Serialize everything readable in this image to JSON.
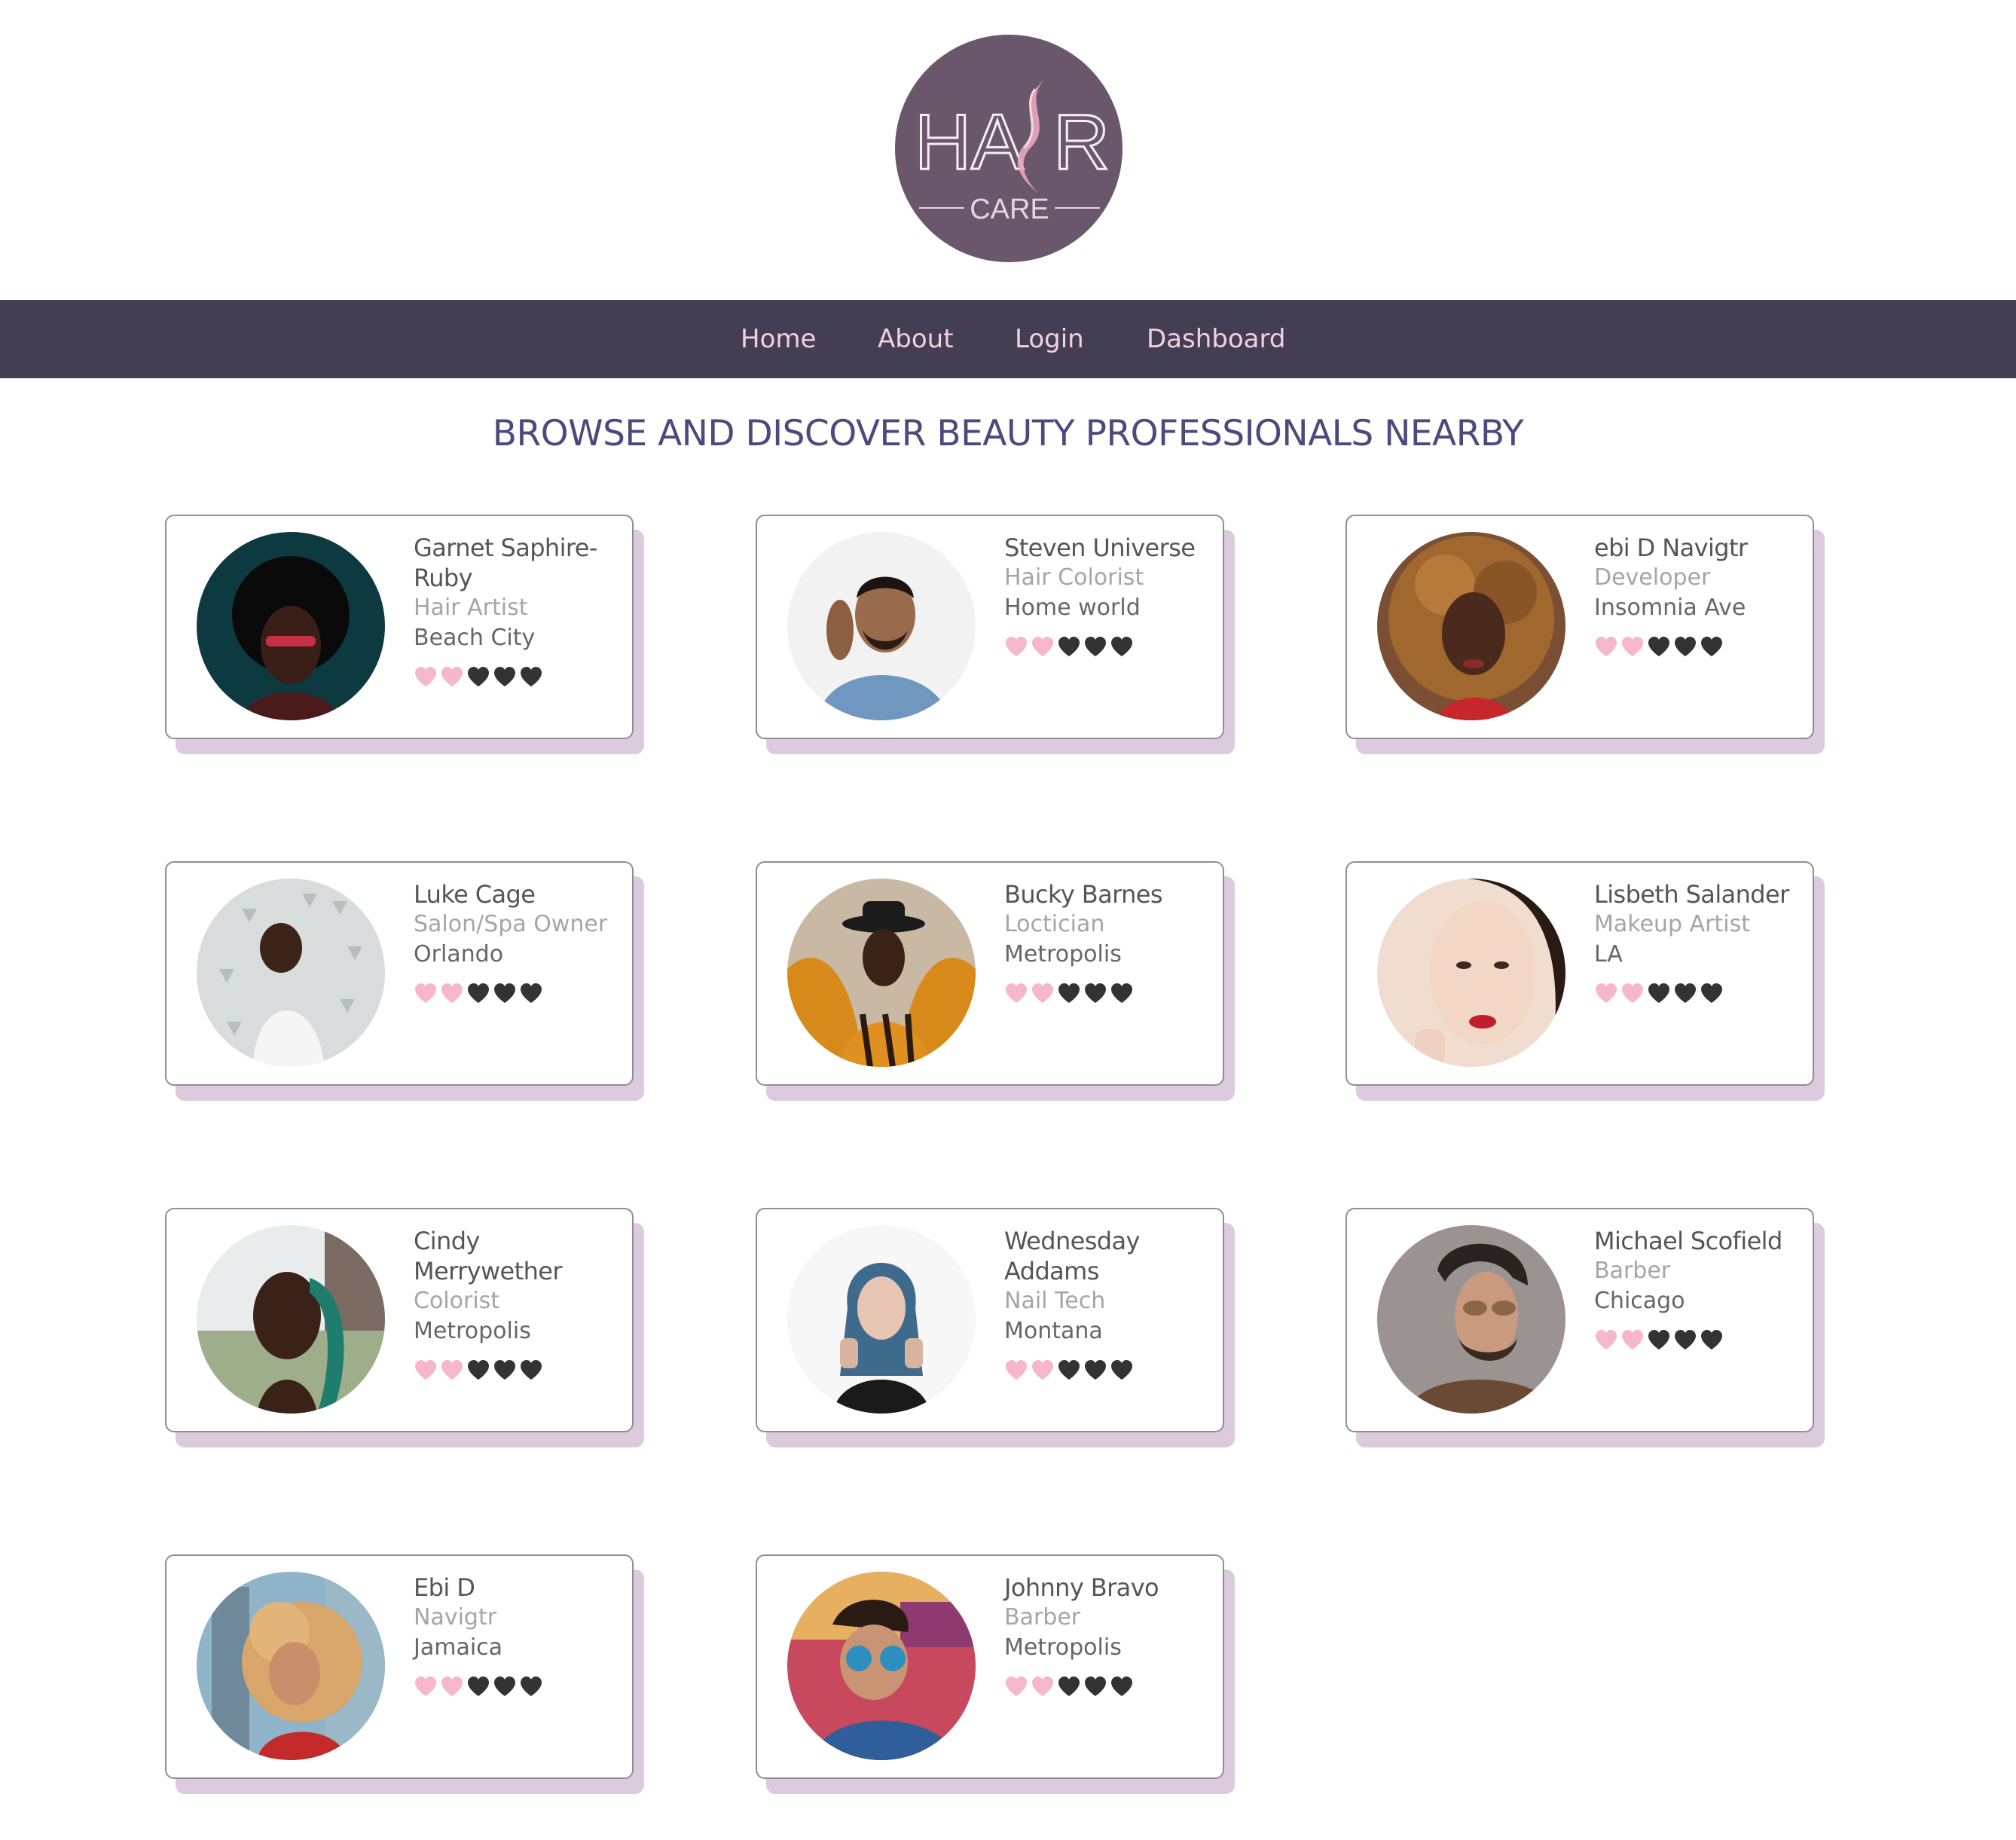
{
  "logo": {
    "line1_left": "HA",
    "line1_right": "R",
    "line2": "CARE"
  },
  "nav": {
    "items": [
      {
        "label": "Home"
      },
      {
        "label": "About"
      },
      {
        "label": "Login"
      },
      {
        "label": "Dashboard"
      }
    ]
  },
  "page": {
    "heading": "BROWSE AND DISCOVER BEAUTY PROFESSIONALS NEARBY"
  },
  "colors": {
    "nav_bg": "#433e54",
    "nav_text": "#f3cfe0",
    "heading": "#4b4a7c",
    "logo_bg": "#6a576b",
    "heart_filled": "#f6b6cb",
    "heart_empty": "#333333",
    "card_shadow": "#dccbdd"
  },
  "professionals": [
    {
      "name": "Garnet Saphire-Ruby",
      "role": "Hair Artist",
      "location": "Beach City",
      "rating": 2,
      "rating_max": 5,
      "avatar": "avatar-photo-afro-woman"
    },
    {
      "name": "Steven Universe",
      "role": "Hair Colorist",
      "location": "Home world",
      "rating": 2,
      "rating_max": 5,
      "avatar": "avatar-photo-smiling-man"
    },
    {
      "name": "ebi D Navigtr",
      "role": "Developer",
      "location": "Insomnia Ave",
      "rating": 2,
      "rating_max": 5,
      "avatar": "avatar-photo-curly-woman"
    },
    {
      "name": "Luke Cage",
      "role": "Salon/Spa Owner",
      "location": "Orlando",
      "rating": 2,
      "rating_max": 5,
      "avatar": "avatar-photo-man-white-shirt"
    },
    {
      "name": "Bucky Barnes",
      "role": "Loctician",
      "location": "Metropolis",
      "rating": 2,
      "rating_max": 5,
      "avatar": "avatar-photo-man-hat"
    },
    {
      "name": "Lisbeth Salander",
      "role": "Makeup Artist",
      "location": "LA",
      "rating": 2,
      "rating_max": 5,
      "avatar": "avatar-photo-woman-red-lips"
    },
    {
      "name": "Cindy Merrywether",
      "role": "Colorist",
      "location": "Metropolis",
      "rating": 2,
      "rating_max": 5,
      "avatar": "avatar-photo-braids-woman"
    },
    {
      "name": "Wednesday Addams",
      "role": "Nail Tech",
      "location": "Montana",
      "rating": 2,
      "rating_max": 5,
      "avatar": "avatar-photo-blue-hair-woman"
    },
    {
      "name": "Michael Scofield",
      "role": "Barber",
      "location": "Chicago",
      "rating": 2,
      "rating_max": 5,
      "avatar": "avatar-photo-man-sunglasses"
    },
    {
      "name": "Ebi D",
      "role": "Navigtr",
      "location": "Jamaica",
      "rating": 2,
      "rating_max": 5,
      "avatar": "avatar-photo-curly-blonde-woman"
    },
    {
      "name": "Johnny Bravo",
      "role": "Barber",
      "location": "Metropolis",
      "rating": 2,
      "rating_max": 5,
      "avatar": "avatar-photo-man-blue-glasses"
    }
  ]
}
